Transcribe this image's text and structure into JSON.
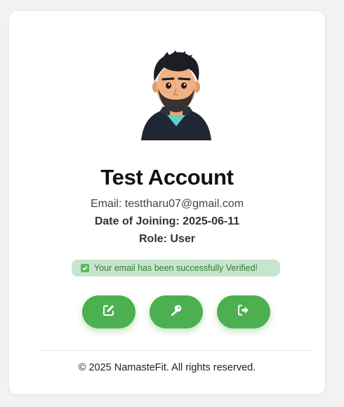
{
  "profile": {
    "name": "Test Account",
    "email_line": "Email: testtharu07@gmail.com",
    "joining_line": "Date of Joining: 2025-06-11",
    "role_line": "Role: User"
  },
  "status": {
    "verified_text": "Your email has been successfully Verified!",
    "icon": "checkbox-checked-icon"
  },
  "actions": [
    {
      "icon": "edit-icon",
      "label": "Edit profile"
    },
    {
      "icon": "key-icon",
      "label": "Change password"
    },
    {
      "icon": "logout-icon",
      "label": "Logout"
    }
  ],
  "footer": {
    "text": "© 2025 NamasteFit. All rights reserved."
  },
  "colors": {
    "accent": "#4caf50",
    "badge_bg": "#c8e4cc",
    "badge_text": "#2f7a3a"
  }
}
